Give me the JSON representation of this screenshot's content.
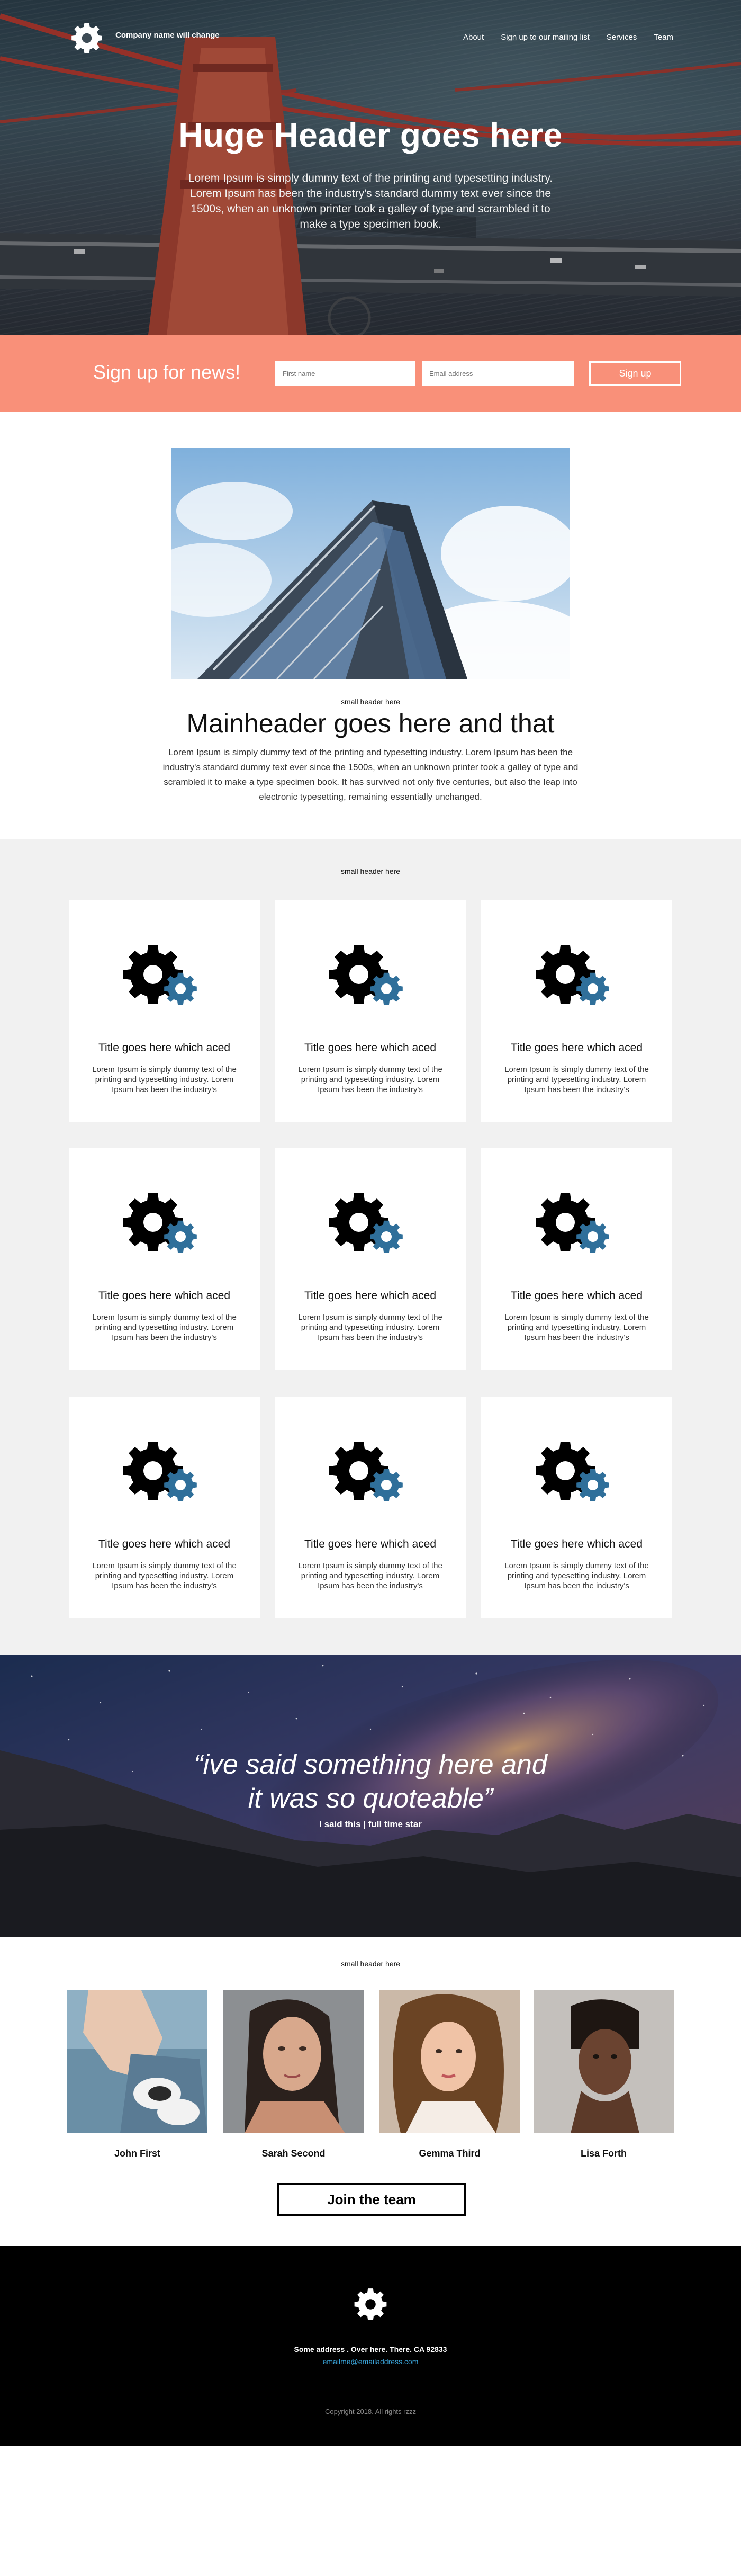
{
  "nav": {
    "company": "Company name will change",
    "links": [
      "About",
      "Sign up to our mailing list",
      "Services",
      "Team"
    ]
  },
  "hero": {
    "title": "Huge Header goes here",
    "lead": "Lorem Ipsum is simply dummy text of the printing and typesetting industry. Lorem Ipsum has been the industry's standard dummy text ever since the 1500s, when an unknown printer took a galley of type and scrambled it to make a type specimen book."
  },
  "signup": {
    "title": "Sign up for news!",
    "first_placeholder": "First name",
    "email_placeholder": "Email address",
    "button": "Sign up"
  },
  "feature": {
    "small": "small header here",
    "title": "Mainheader goes here and that",
    "body": "Lorem Ipsum is simply dummy text of the printing and typesetting industry. Lorem Ipsum has been the industry's standard dummy text ever since the 1500s, when an unknown printer took a galley of type and scrambled it to make a type specimen book. It has survived not only five centuries, but also the leap into electronic typesetting, remaining essentially unchanged."
  },
  "services": {
    "small": "small header here",
    "cards": [
      {
        "title": "Title goes here which aced",
        "text": "Lorem Ipsum is simply dummy text of the printing and typesetting industry. Lorem Ipsum has been the industry's"
      },
      {
        "title": "Title goes here which aced",
        "text": "Lorem Ipsum is simply dummy text of the printing and typesetting industry. Lorem Ipsum has been the industry's"
      },
      {
        "title": "Title goes here which aced",
        "text": "Lorem Ipsum is simply dummy text of the printing and typesetting industry. Lorem Ipsum has been the industry's"
      },
      {
        "title": "Title goes here which aced",
        "text": "Lorem Ipsum is simply dummy text of the printing and typesetting industry. Lorem Ipsum has been the industry's"
      },
      {
        "title": "Title goes here which aced",
        "text": "Lorem Ipsum is simply dummy text of the printing and typesetting industry. Lorem Ipsum has been the industry's"
      },
      {
        "title": "Title goes here which aced",
        "text": "Lorem Ipsum is simply dummy text of the printing and typesetting industry. Lorem Ipsum has been the industry's"
      },
      {
        "title": "Title goes here which aced",
        "text": "Lorem Ipsum is simply dummy text of the printing and typesetting industry. Lorem Ipsum has been the industry's"
      },
      {
        "title": "Title goes here which aced",
        "text": "Lorem Ipsum is simply dummy text of the printing and typesetting industry. Lorem Ipsum has been the industry's"
      },
      {
        "title": "Title goes here which aced",
        "text": "Lorem Ipsum is simply dummy text of the printing and typesetting industry. Lorem Ipsum has been the industry's"
      }
    ],
    "icon": "gear-icon"
  },
  "quote": {
    "line1": "“ive said something here and",
    "line2": "it was so quoteable”",
    "cite": "I said this | full time star"
  },
  "team": {
    "small": "small header here",
    "members": [
      {
        "name": "John First"
      },
      {
        "name": "Sarah Second"
      },
      {
        "name": "Gemma Third"
      },
      {
        "name": "Lisa Forth"
      }
    ],
    "join": "Join the team"
  },
  "footer": {
    "address": "Some address . Over here. There. CA 92833",
    "email": "emailme@emailaddress.com",
    "copyright": "Copyright 2018. All rights rzzz"
  },
  "colors": {
    "signup_bg": "#f99079",
    "gear_blue": "#2f6f9a",
    "footer_bg": "#000000",
    "link_blue": "#3aa3d8"
  }
}
